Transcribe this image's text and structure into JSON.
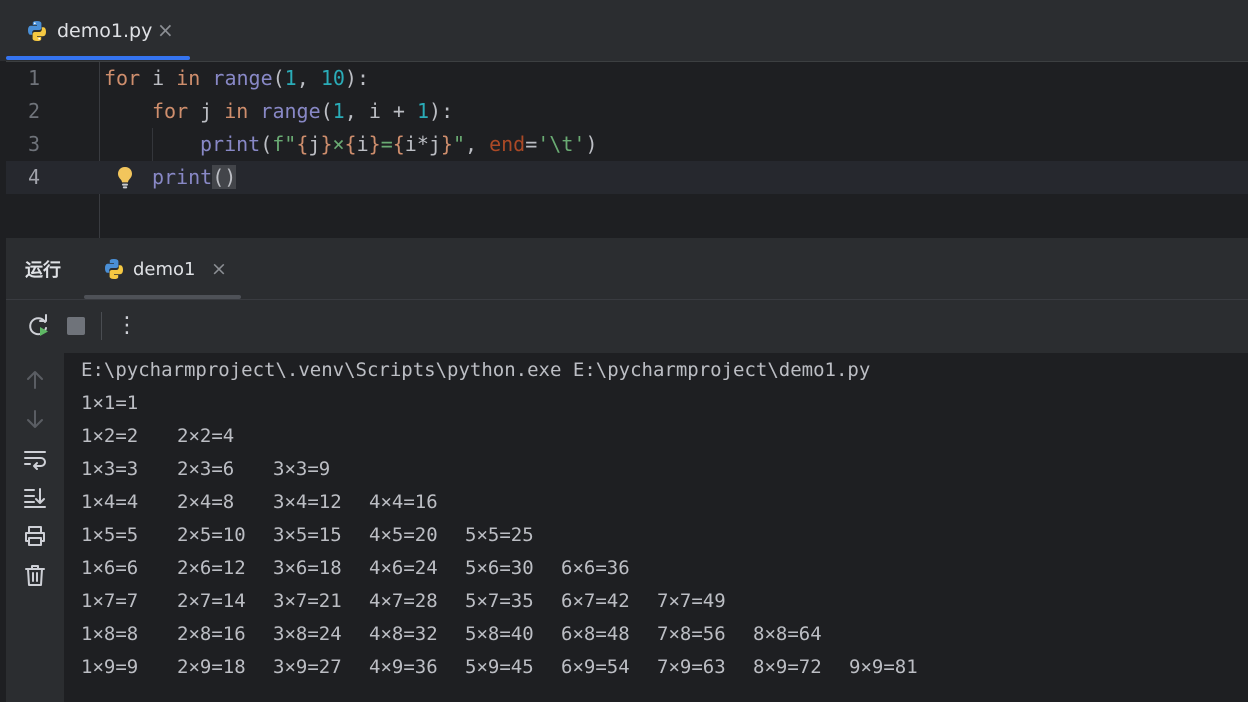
{
  "editor_tab": {
    "filename": "demo1.py",
    "close_glyph": "×",
    "icon": "python-file-icon"
  },
  "editor": {
    "lines": [
      {
        "num": "1"
      },
      {
        "num": "2"
      },
      {
        "num": "3"
      },
      {
        "num": "4"
      }
    ],
    "tokens": {
      "for": "for",
      "in": "in",
      "range": "range",
      "print": "print",
      "end": "end",
      "i": "i",
      "j": "j",
      "one": "1",
      "ten": "10",
      "fstr_prefix": "f\"",
      "brace_open": "{",
      "brace_close": "}",
      "times": "×",
      "equals": "=",
      "i_times_j": "i*j",
      "quote": "\"",
      "tab_escape": "'\\t'",
      "comma": ", ",
      "plus": " + ",
      "lparen": "(",
      "rparen": ")",
      "colon": ":",
      "assign": "=",
      "empty_parens": "()"
    }
  },
  "run_panel": {
    "title": "运行",
    "tab_label": "demo1",
    "tab_close": "×",
    "more_glyph": "⋮",
    "command": "E:\\pycharmproject\\.venv\\Scripts\\python.exe E:\\pycharmproject\\demo1.py",
    "output": [
      [
        "1×1=1"
      ],
      [
        "1×2=2",
        "2×2=4"
      ],
      [
        "1×3=3",
        "2×3=6",
        "3×3=9"
      ],
      [
        "1×4=4",
        "2×4=8",
        "3×4=12",
        "4×4=16"
      ],
      [
        "1×5=5",
        "2×5=10",
        "3×5=15",
        "4×5=20",
        "5×5=25"
      ],
      [
        "1×6=6",
        "2×6=12",
        "3×6=18",
        "4×6=24",
        "5×6=30",
        "6×6=36"
      ],
      [
        "1×7=7",
        "2×7=14",
        "3×7=21",
        "4×7=28",
        "5×7=35",
        "6×7=42",
        "7×7=49"
      ],
      [
        "1×8=8",
        "2×8=16",
        "3×8=24",
        "4×8=32",
        "5×8=40",
        "6×8=48",
        "7×8=56",
        "8×8=64"
      ],
      [
        "1×9=9",
        "2×9=18",
        "3×9=27",
        "4×9=36",
        "5×9=45",
        "6×9=54",
        "7×9=63",
        "8×9=72",
        "9×9=81"
      ]
    ]
  },
  "colors": {
    "background": "#1e1f22",
    "panel": "#2b2d30",
    "accent": "#3574f0",
    "keyword": "#cf8e6d",
    "builtin": "#8888c6",
    "number": "#2aacb8",
    "string": "#6aab73",
    "text": "#bcbec4"
  }
}
